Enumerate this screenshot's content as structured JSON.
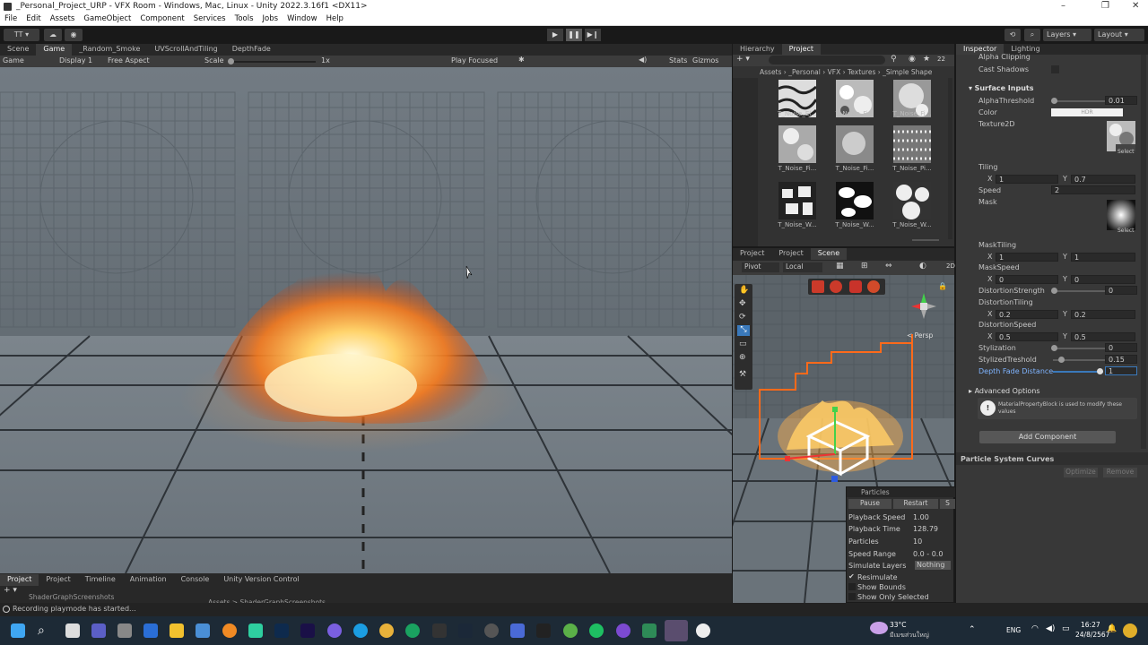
{
  "window": {
    "title": "_Personal_Project_URP - VFX Room - Windows, Mac, Linux - Unity 2022.3.16f1 <DX11>",
    "controls": [
      "–",
      "❐",
      "✕"
    ]
  },
  "menu": [
    "File",
    "Edit",
    "Assets",
    "GameObject",
    "Component",
    "Services",
    "Tools",
    "Jobs",
    "Window",
    "Help"
  ],
  "toolbar": {
    "account": "TT",
    "layers": "Layers",
    "layout": "Layout"
  },
  "left_tabs": [
    "Scene",
    "Game",
    "_Random_Smoke",
    "UVScrollAndTiling",
    "DepthFade"
  ],
  "gamebar": {
    "mode": "Game",
    "display": "Display 1",
    "aspect": "Free Aspect",
    "scale_label": "Scale",
    "scale_value": "1x",
    "play_focused": "Play Focused",
    "stats": "Stats",
    "gizmos": "Gizmos"
  },
  "hier_tabs": [
    "Hierarchy",
    "Project"
  ],
  "project": {
    "count": "22",
    "breadcrumb": [
      "Assets",
      "_Personal",
      "VFX",
      "Textures",
      "_Simple Shape"
    ],
    "items": [
      "T_Noise_El...",
      "T_Noise_Fi...",
      "T_Noise_Fi...",
      "T_Noise_Fi...",
      "T_Noise_Fi...",
      "T_Noise_Pi...",
      "T_Noise_W...",
      "T_Noise_W...",
      "T_Noise_W..."
    ]
  },
  "scene_tabs": [
    "Project",
    "Project",
    "Scene"
  ],
  "scene": {
    "pivot": "Pivot",
    "local": "Local",
    "persp": "< Persp",
    "zoom": "2D"
  },
  "inspector_tabs": [
    "Inspector",
    "Lighting"
  ],
  "inspector": {
    "alpha_clipping": "Alpha Clipping",
    "cast_shadows": "Cast Shadows",
    "surface_inputs": "Surface Inputs",
    "alpha_threshold_label": "AlphaThreshold",
    "alpha_threshold": "0.01",
    "color_label": "Color",
    "color_hdr": "HDR",
    "texture2d_label": "Texture2D",
    "select": "Select",
    "tiling_label": "Tiling",
    "tiling_x": "1",
    "tiling_y": "0.7",
    "speed_label": "Speed",
    "speed": "2",
    "mask_label": "Mask",
    "mask_tiling_label": "MaskTiling",
    "mask_tiling_x": "1",
    "mask_tiling_y": "1",
    "mask_speed_label": "MaskSpeed",
    "mask_speed_x": "0",
    "mask_speed_y": "0",
    "distortion_strength_label": "DistortionStrength",
    "distortion_strength": "0",
    "distortion_tiling_label": "DistortionTiling",
    "distortion_tiling_x": "0.2",
    "distortion_tiling_y": "0.2",
    "distortion_speed_label": "DistortionSpeed",
    "distortion_speed_x": "0.5",
    "distortion_speed_y": "0.5",
    "stylization_label": "Stylization",
    "stylization": "0",
    "stylized_threshold_label": "StylizedTreshold",
    "stylized_threshold": "0.15",
    "depth_fade_label": "Depth Fade Distance",
    "depth_fade": "1",
    "advanced_options": "Advanced Options",
    "info_text": "MaterialPropertyBlock is used to modify these values",
    "add_component": "Add Component",
    "particle_curves": "Particle System Curves",
    "optimize": "Optimize",
    "remove": "Remove",
    "x": "X",
    "y": "Y"
  },
  "particles": {
    "title": "Particles",
    "pause": "Pause",
    "restart": "Restart",
    "stop": "S",
    "playback_speed_label": "Playback Speed",
    "playback_speed": "1.00",
    "playback_time_label": "Playback Time",
    "playback_time": "128.79",
    "particles_label": "Particles",
    "particles": "10",
    "speed_range_label": "Speed Range",
    "speed_range": "0.0 - 0.0",
    "simulate_layers_label": "Simulate Layers",
    "simulate_layers": "Nothing",
    "resimulate": "Resimulate",
    "show_bounds": "Show Bounds",
    "show_only_selected": "Show Only Selected"
  },
  "bottom_tabs": [
    "Project",
    "Project",
    "Timeline",
    "Animation",
    "Console",
    "Unity Version Control"
  ],
  "bottom": {
    "folder": "ShaderGraphScreenshots",
    "crumb": "Assets > ShaderGraphScreenshots"
  },
  "status": "Recording playmode has started...",
  "taskbar": {
    "temp": "33°C",
    "weather": "มีเมฆส่วนใหญ่",
    "lang": "ENG",
    "time": "16:27",
    "date": "24/8/2567"
  },
  "colors": {
    "editor_bg": "#383838",
    "accent": "#3a79bb",
    "fire": "#ffb347"
  }
}
